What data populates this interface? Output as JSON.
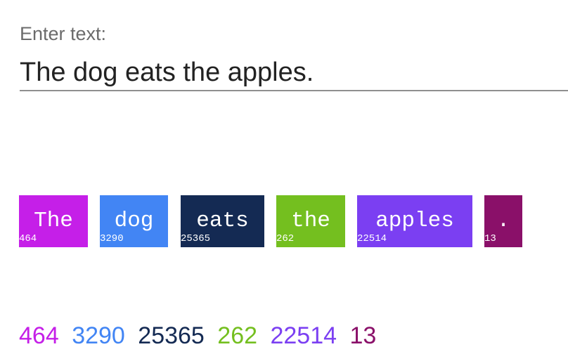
{
  "input": {
    "label": "Enter text:",
    "value": "The dog eats the apples."
  },
  "tokens": [
    {
      "text": "The",
      "id": "464",
      "color": "#c51fe8"
    },
    {
      "text": "dog",
      "id": "3290",
      "color": "#4285f4"
    },
    {
      "text": "eats",
      "id": "25365",
      "color": "#142a53"
    },
    {
      "text": "the",
      "id": "262",
      "color": "#74bf1f"
    },
    {
      "text": "apples",
      "id": "22514",
      "color": "#7b3ff2"
    },
    {
      "text": ".",
      "id": "13",
      "color": "#8a1069"
    }
  ]
}
